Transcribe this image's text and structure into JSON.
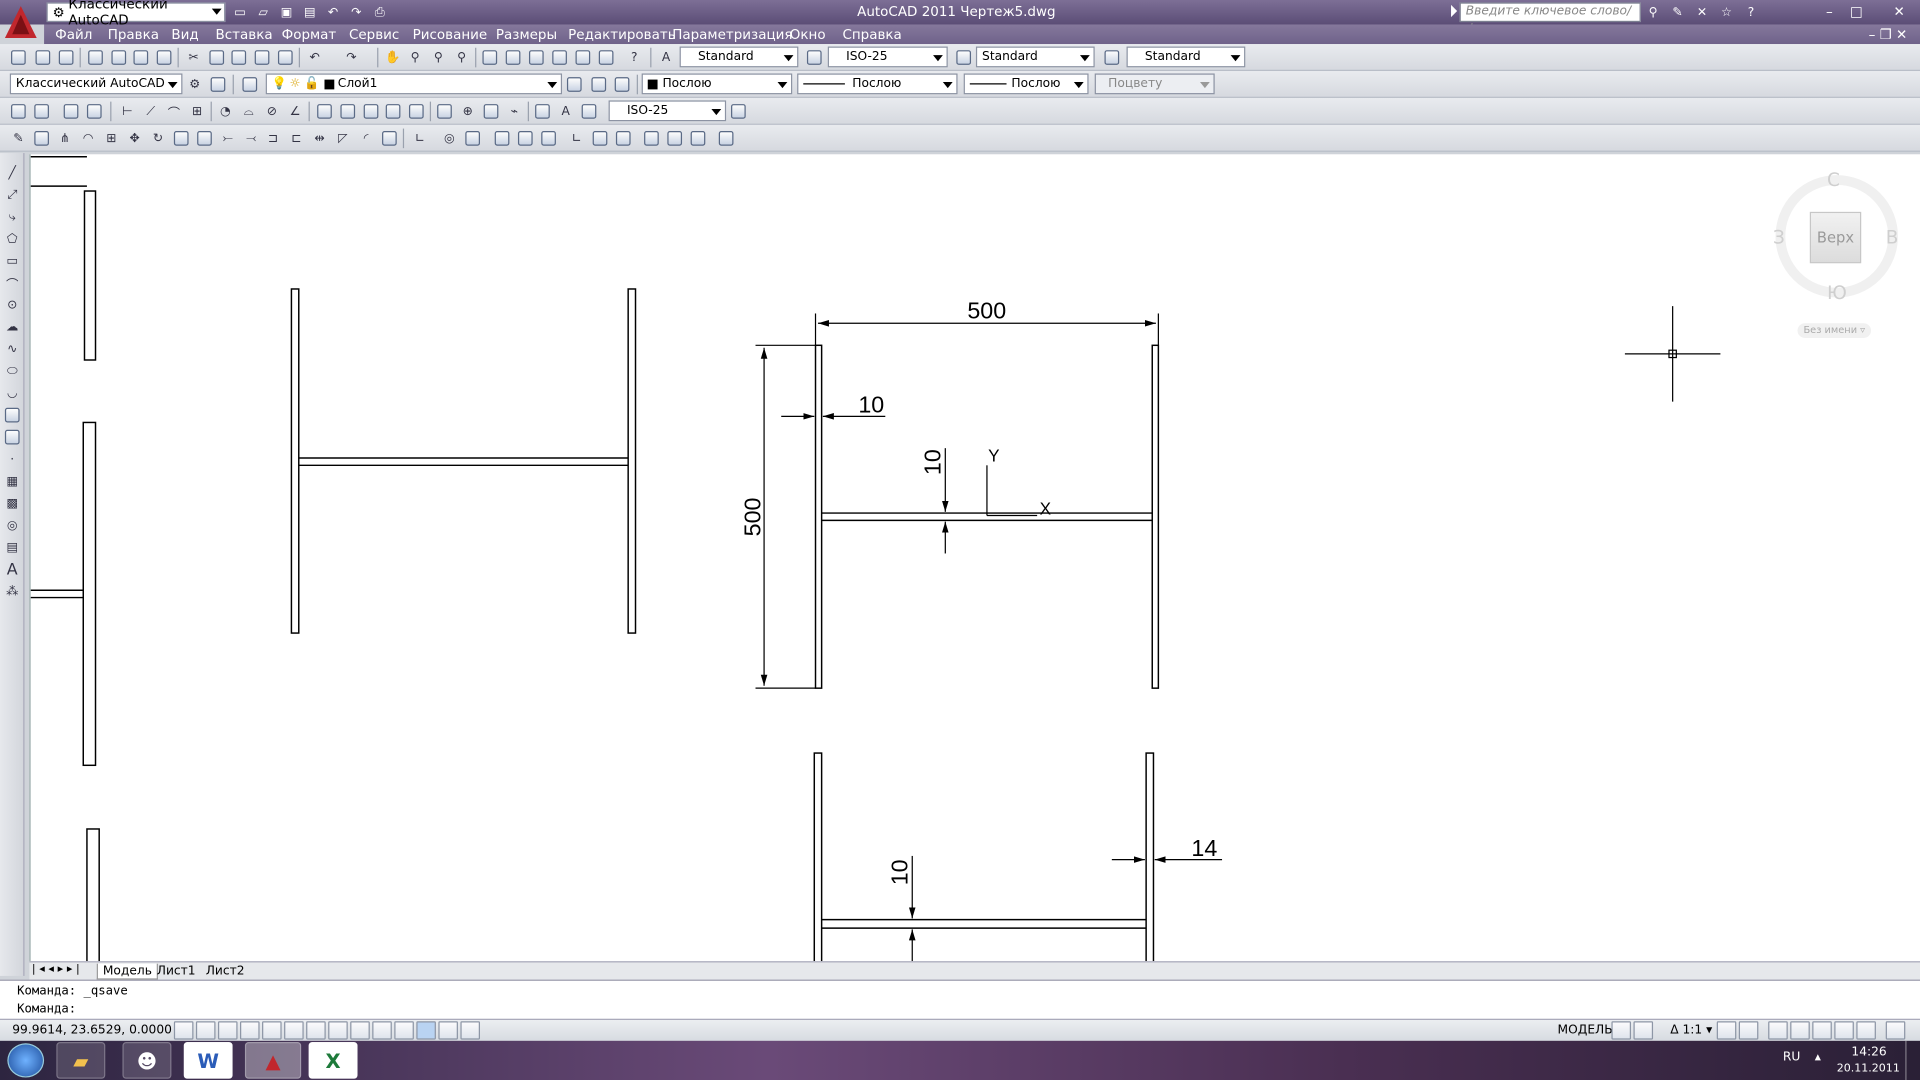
{
  "titlebar": {
    "workspace": "Классический AutoCAD",
    "title": "AutoCAD 2011   Чертеж5.dwg",
    "search_placeholder": "Введите ключевое слово/фразу"
  },
  "menu": [
    "Файл",
    "Правка",
    "Вид",
    "Вставка",
    "Формат",
    "Сервис",
    "Рисование",
    "Размеры",
    "Редактировать",
    "Параметризация",
    "Окно",
    "Справка"
  ],
  "toolbar_styles": {
    "text_style": "Standard",
    "dim_style": "ISO-25",
    "table_style": "Standard",
    "mleader_style": "Standard"
  },
  "layers": {
    "workspace": "Классический AutoCAD",
    "current_layer": "Слой1",
    "color": "Послою",
    "linetype": "Послою",
    "lineweight": "Послою",
    "plotstyle": "Поцвету"
  },
  "dim_toolbar": {
    "dim_style": "ISO-25"
  },
  "drawing": {
    "dims": {
      "top_width": "500",
      "left_height": "500",
      "web_thickness": "10",
      "flange_thickness": "10",
      "bottom_web": "10",
      "bottom_flange": "14"
    },
    "ucs": {
      "x": "X",
      "y": "Y"
    }
  },
  "viewcube": {
    "north": "С",
    "south": "Ю",
    "west": "З",
    "east": "В",
    "face": "Верх",
    "ucs_menu": "Без имени"
  },
  "tabs": [
    "Модель",
    "Лист1",
    "Лист2"
  ],
  "command": {
    "line1": "Команда:  _qsave",
    "line2": "Команда:"
  },
  "status": {
    "coords": "99.9614,  23.6529, 0.0000",
    "model": "МОДЕЛЬ",
    "scale": "1:1"
  },
  "taskbar": {
    "lang": "RU",
    "time": "14:26",
    "date": "20.11.2011"
  },
  "colors": {
    "accent": "#c1272d",
    "title_bg": "#5b4d76",
    "canvas": "#ffffff"
  }
}
